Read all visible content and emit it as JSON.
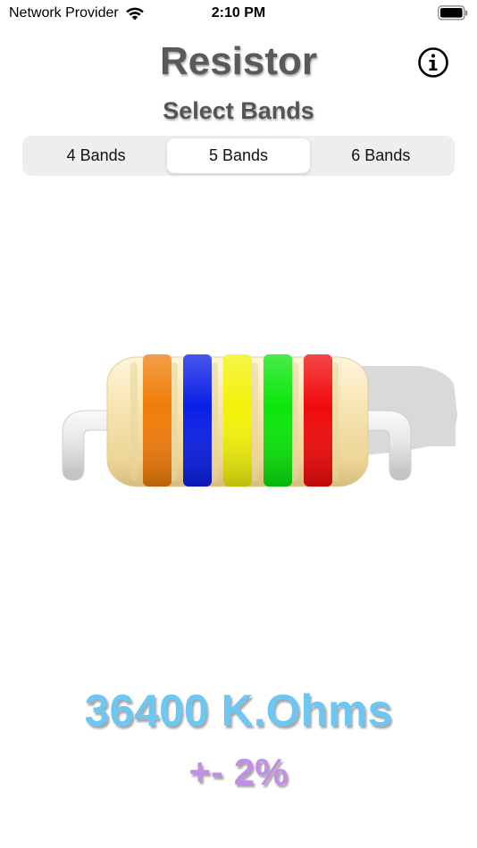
{
  "status_bar": {
    "carrier": "Network Provider",
    "time": "2:10 PM",
    "wifi_icon": "wifi-icon",
    "battery_icon": "battery-icon"
  },
  "header": {
    "title": "Resistor",
    "subtitle": "Select Bands",
    "info_icon": "info-icon"
  },
  "band_selector": {
    "options": [
      "4 Bands",
      "5 Bands",
      "6 Bands"
    ],
    "selected": "5 Bands"
  },
  "resistor": {
    "body_color": "#f3dfa8",
    "lead_color": "#e6e6e6",
    "bands": [
      {
        "name": "orange",
        "color": "#f07d0a"
      },
      {
        "name": "blue",
        "color": "#0a1fe6"
      },
      {
        "name": "yellow",
        "color": "#f2f20a"
      },
      {
        "name": "green",
        "color": "#0ae60a"
      },
      {
        "name": "red",
        "color": "#f00a0a"
      }
    ]
  },
  "readout": {
    "value": "36400 K.Ohms",
    "tolerance": "+- 2%",
    "value_color": "#6cc8f2",
    "tolerance_color": "#c18fe6"
  }
}
